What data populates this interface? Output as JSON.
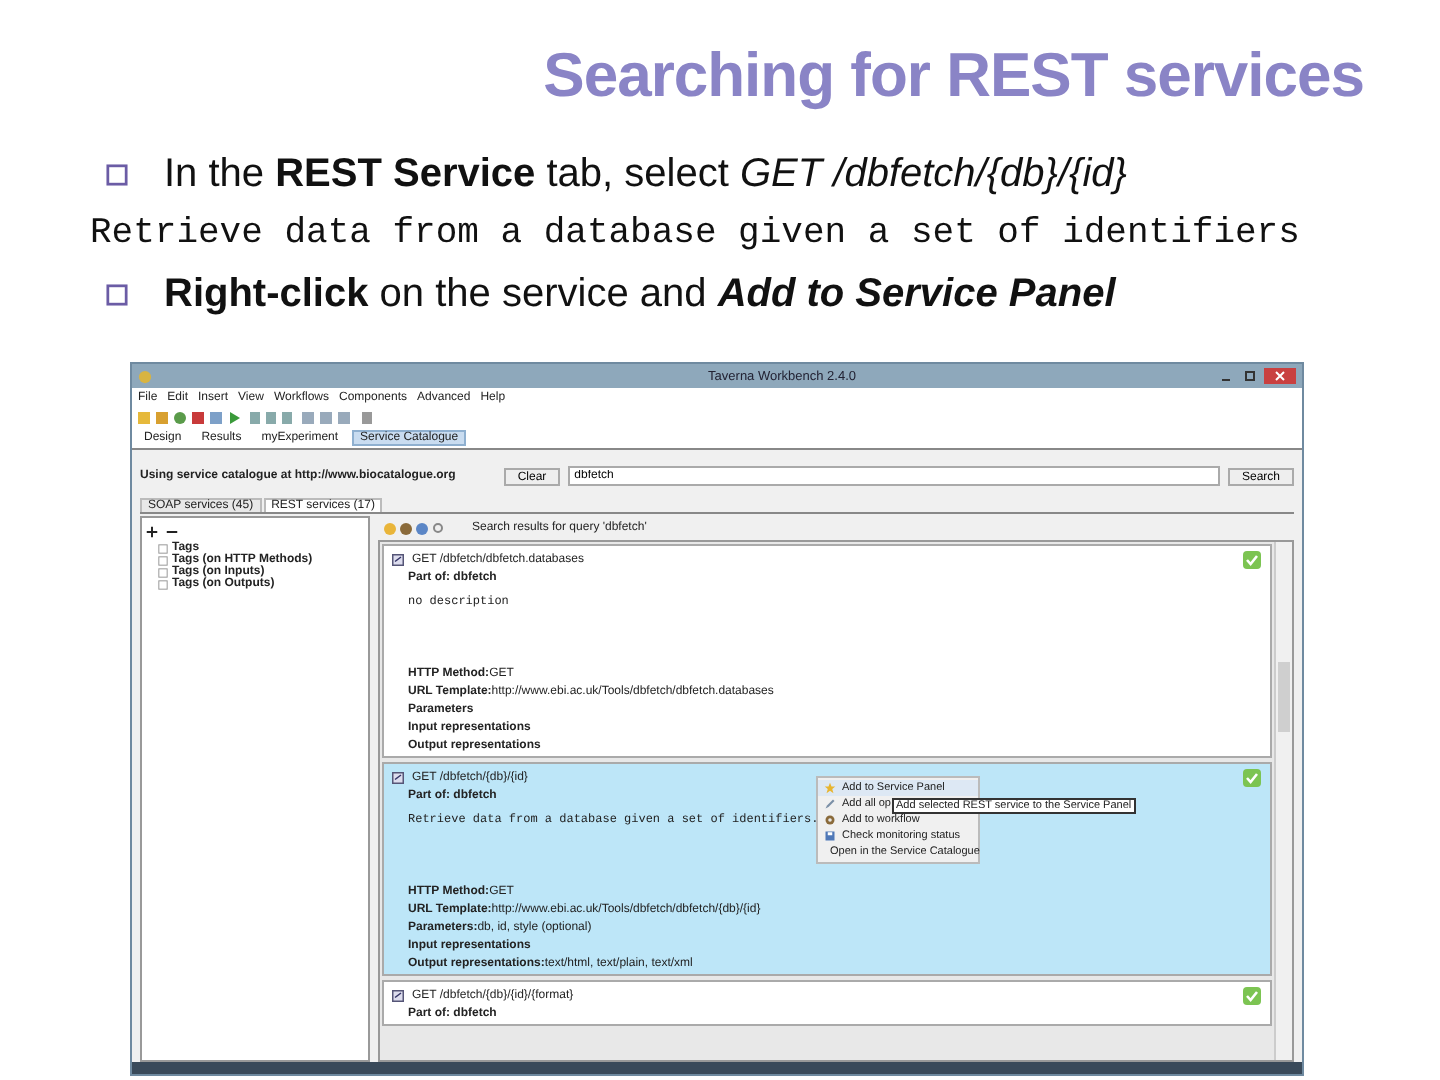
{
  "slide": {
    "title": "Searching for REST services",
    "bullets": [
      {
        "kind": "bullet",
        "em_bold": false,
        "text": "In the **REST Service** tab, select *GET /dbfetch/{db}/{id}*"
      },
      {
        "kind": "code",
        "text": "Retrieve data from a database given a set of identifiers"
      },
      {
        "kind": "bullet",
        "em_bold": true,
        "text": "**Right-click** on the service and *Add to Service Panel*"
      }
    ]
  },
  "window": {
    "title": "Taverna Workbench 2.4.0",
    "menu": [
      "File",
      "Edit",
      "Insert",
      "View",
      "Workflows",
      "Components",
      "Advanced",
      "Help"
    ],
    "perspectives": [
      {
        "label": "Design",
        "selected": false
      },
      {
        "label": "Results",
        "selected": false
      },
      {
        "label": "myExperiment",
        "selected": false
      },
      {
        "label": "Service Catalogue",
        "selected": true
      }
    ],
    "catalogue_label": "Using service catalogue at http://www.biocatalogue.org",
    "clear_button": "Clear",
    "search": {
      "value": "dbfetch"
    },
    "search_button": "Search",
    "tabs": [
      {
        "label": "SOAP services (45)",
        "selected": false
      },
      {
        "label": "REST services (17)",
        "selected": true
      }
    ],
    "tree": {
      "items": [
        {
          "label": "Tags"
        },
        {
          "label": "Tags (on HTTP Methods)"
        },
        {
          "label": "Tags (on Inputs)"
        },
        {
          "label": "Tags (on Outputs)"
        }
      ]
    },
    "results_header": "Search results for query 'dbfetch'",
    "results": [
      {
        "title": "GET /dbfetch/dbfetch.databases",
        "selected": false,
        "part_of": "Part of: dbfetch",
        "description": "no description",
        "fields": [
          {
            "label": "HTTP Method:",
            "value": "GET"
          },
          {
            "label": "URL Template:",
            "value": "http://www.ebi.ac.uk/Tools/dbfetch/dbfetch.databases"
          },
          {
            "label": "Parameters"
          },
          {
            "label": "Input representations"
          },
          {
            "label": "Output representations"
          }
        ]
      },
      {
        "title": "GET /dbfetch/{db}/{id}",
        "selected": true,
        "part_of": "Part of: dbfetch",
        "description": "Retrieve data from a database given a set of identifiers.",
        "fields": [
          {
            "label": "HTTP Method:",
            "value": "GET"
          },
          {
            "label": "URL Template:",
            "value": "http://www.ebi.ac.uk/Tools/dbfetch/dbfetch/{db}/{id}"
          },
          {
            "label": "Parameters:",
            "value": "db, id, style (optional)"
          },
          {
            "label": "Input representations"
          },
          {
            "label": "Output representations:",
            "value": "text/html, text/plain, text/xml"
          }
        ]
      },
      {
        "title": "GET /dbfetch/{db}/{id}/{format}",
        "selected": false,
        "part_of": "Part of: dbfetch"
      }
    ],
    "context_menu": {
      "items": [
        {
          "label": "Add to Service Panel",
          "selected": true
        },
        {
          "label": "Add all op",
          "selected": false
        },
        {
          "label": "Add to workflow",
          "selected": false
        },
        {
          "label": "Check monitoring status",
          "selected": false
        },
        {
          "label": "Open in the Service Catalogue",
          "selected": false
        }
      ],
      "tooltip": "Add selected REST service to the Service Panel"
    }
  }
}
